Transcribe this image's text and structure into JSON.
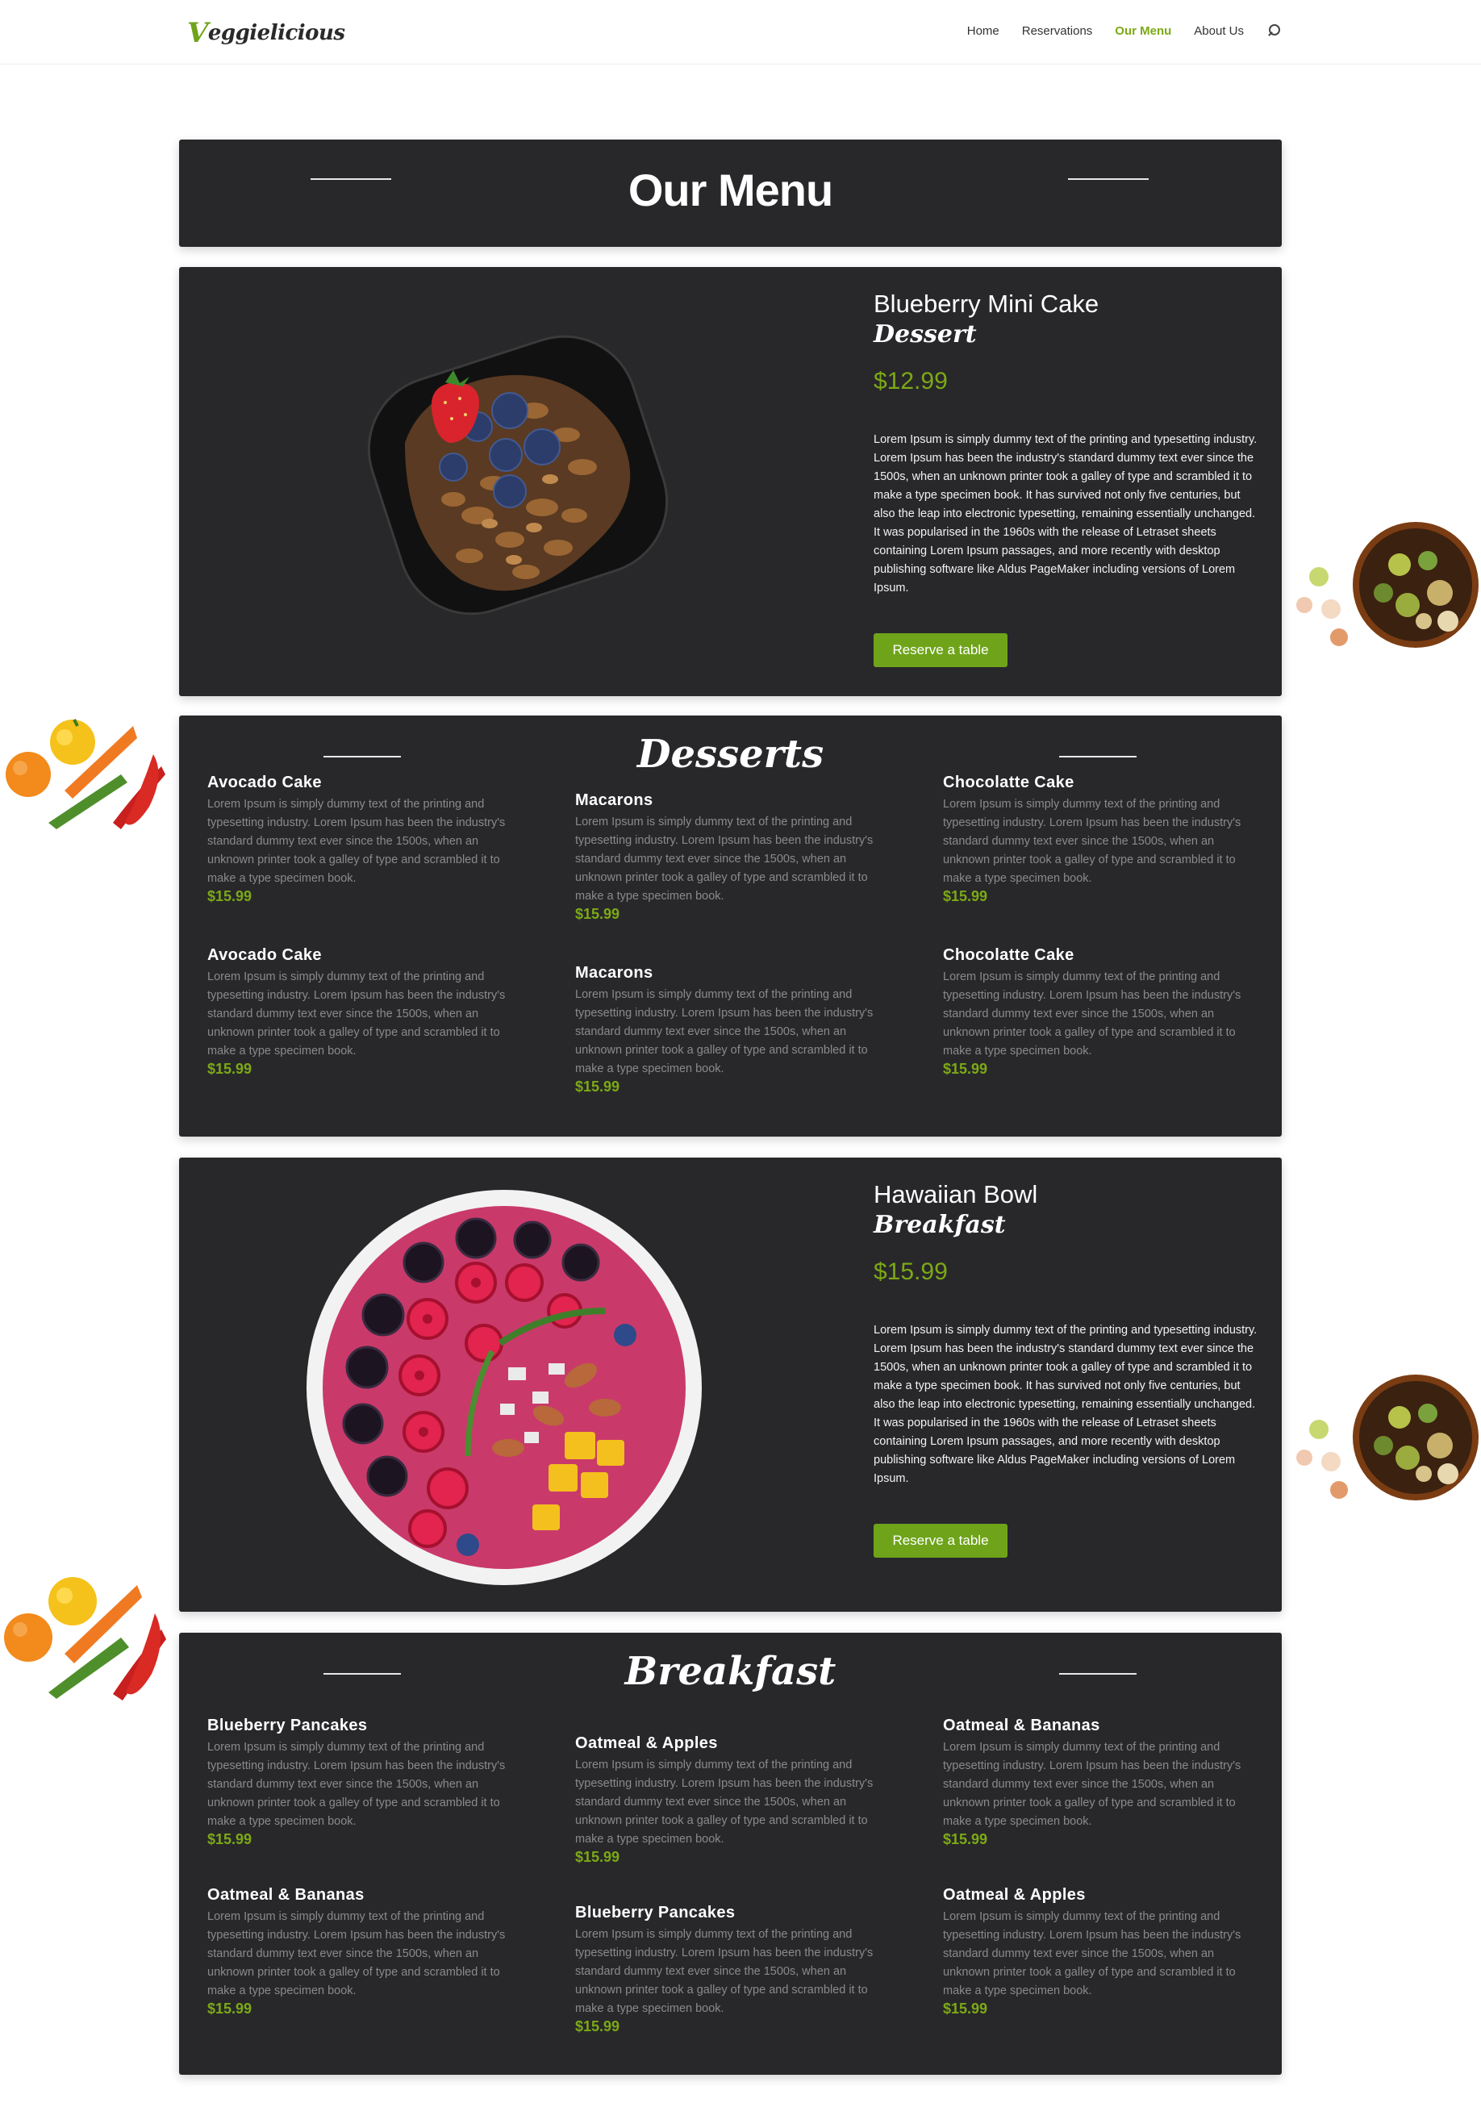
{
  "header": {
    "logo": "Veggielicious",
    "nav": [
      "Home",
      "Reservations",
      "Our Menu",
      "About Us"
    ],
    "active_nav": "Our Menu"
  },
  "page_title": "Our Menu",
  "featured": [
    {
      "name": "Blueberry Mini Cake",
      "category": "Dessert",
      "price": "$12.99",
      "description": "Lorem Ipsum is simply dummy text of the printing and typesetting industry. Lorem Ipsum has been the industry's standard dummy text ever since the 1500s, when an unknown printer took a galley of type and scrambled it to make a type specimen book. It has survived not only five centuries, but also the leap into electronic typesetting, remaining essentially unchanged. It was popularised in the 1960s with the release of Letraset sheets containing Lorem Ipsum passages, and more recently with desktop publishing software like Aldus PageMaker including versions of Lorem Ipsum.",
      "button": "Reserve a table"
    },
    {
      "name": "Hawaiian Bowl",
      "category": "Breakfast",
      "price": "$15.99",
      "description": "Lorem Ipsum is simply dummy text of the printing and typesetting industry. Lorem Ipsum has been the industry's standard dummy text ever since the 1500s, when an unknown printer took a galley of type and scrambled it to make a type specimen book. It has survived not only five centuries, but also the leap into electronic typesetting, remaining essentially unchanged. It was popularised in the 1960s with the release of Letraset sheets containing Lorem Ipsum passages, and more recently with desktop publishing software like Aldus PageMaker including versions of Lorem Ipsum.",
      "button": "Reserve a table"
    }
  ],
  "desserts": {
    "title": "Desserts",
    "items": [
      {
        "name": "Avocado Cake",
        "description": "Lorem Ipsum is simply dummy text of the printing and typesetting industry. Lorem Ipsum has been the industry's standard dummy text ever since the 1500s, when an unknown printer took a galley of type and scrambled it to make a type specimen book.",
        "price": "$15.99"
      },
      {
        "name": "Macarons",
        "description": "Lorem Ipsum is simply dummy text of the printing and typesetting industry. Lorem Ipsum has been the industry's standard dummy text ever since the 1500s, when an unknown printer took a galley of type and scrambled it to make a type specimen book.",
        "price": "$15.99"
      },
      {
        "name": "Chocolatte Cake",
        "description": "Lorem Ipsum is simply dummy text of the printing and typesetting industry. Lorem Ipsum has been the industry's standard dummy text ever since the 1500s, when an unknown printer took a galley of type and scrambled it to make a type specimen book.",
        "price": "$15.99"
      },
      {
        "name": "Avocado Cake",
        "description": "Lorem Ipsum is simply dummy text of the printing and typesetting industry. Lorem Ipsum has been the industry's standard dummy text ever since the 1500s, when an unknown printer took a galley of type and scrambled it to make a type specimen book.",
        "price": "$15.99"
      },
      {
        "name": "Macarons",
        "description": "Lorem Ipsum is simply dummy text of the printing and typesetting industry. Lorem Ipsum has been the industry's standard dummy text ever since the 1500s, when an unknown printer took a galley of type and scrambled it to make a type specimen book.",
        "price": "$15.99"
      },
      {
        "name": "Chocolatte Cake",
        "description": "Lorem Ipsum is simply dummy text of the printing and typesetting industry. Lorem Ipsum has been the industry's standard dummy text ever since the 1500s, when an unknown printer took a galley of type and scrambled it to make a type specimen book.",
        "price": "$15.99"
      }
    ]
  },
  "breakfast": {
    "title": "Breakfast",
    "items": [
      {
        "name": "Blueberry Pancakes",
        "description": "Lorem Ipsum is simply dummy text of the printing and typesetting industry. Lorem Ipsum has been the industry's standard dummy text ever since the 1500s, when an unknown printer took a galley of type and scrambled it to make a type specimen book.",
        "price": "$15.99"
      },
      {
        "name": "Oatmeal & Apples",
        "description": "Lorem Ipsum is simply dummy text of the printing and typesetting industry. Lorem Ipsum has been the industry's standard dummy text ever since the 1500s, when an unknown printer took a galley of type and scrambled it to make a type specimen book.",
        "price": "$15.99"
      },
      {
        "name": "Oatmeal & Bananas",
        "description": "Lorem Ipsum is simply dummy text of the printing and typesetting industry. Lorem Ipsum has been the industry's standard dummy text ever since the 1500s, when an unknown printer took a galley of type and scrambled it to make a type specimen book.",
        "price": "$15.99"
      },
      {
        "name": "Oatmeal & Bananas",
        "description": "Lorem Ipsum is simply dummy text of the printing and typesetting industry. Lorem Ipsum has been the industry's standard dummy text ever since the 1500s, when an unknown printer took a galley of type and scrambled it to make a type specimen book.",
        "price": "$15.99"
      },
      {
        "name": "Blueberry Pancakes",
        "description": "Lorem Ipsum is simply dummy text of the printing and typesetting industry. Lorem Ipsum has been the industry's standard dummy text ever since the 1500s, when an unknown printer took a galley of type and scrambled it to make a type specimen book.",
        "price": "$15.99"
      },
      {
        "name": "Oatmeal & Apples",
        "description": "Lorem Ipsum is simply dummy text of the printing and typesetting industry. Lorem Ipsum has been the industry's standard dummy text ever since the 1500s, when an unknown printer took a galley of type and scrambled it to make a type specimen book.",
        "price": "$15.99"
      }
    ]
  },
  "colors": {
    "accent": "#7ca915",
    "panel": "#28282b",
    "muted_text": "#8a8a8d"
  }
}
